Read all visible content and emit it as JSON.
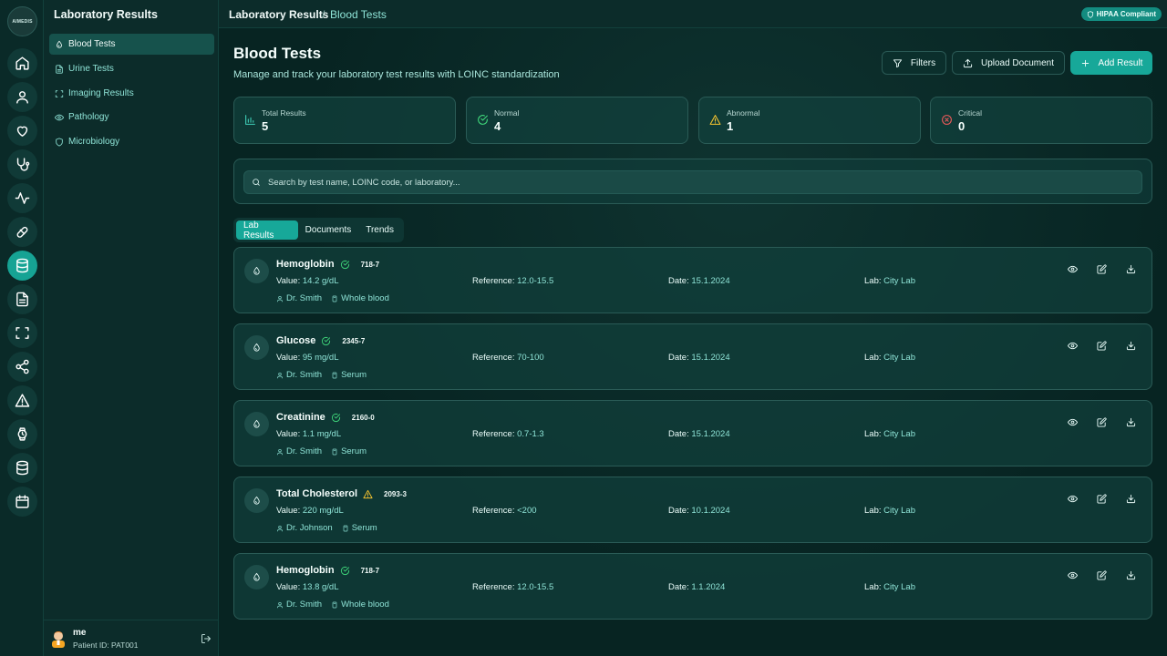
{
  "app": {
    "logo_text": "AIMEDIS",
    "rail_icons": [
      "home-icon",
      "user-icon",
      "heart-icon",
      "stethoscope-icon",
      "activity-icon",
      "pill-icon",
      "database-icon",
      "document-icon",
      "scan-icon",
      "share-icon",
      "alert-triangle-icon",
      "watch-icon",
      "database-icon",
      "calendar-icon"
    ],
    "active_rail": "database-icon"
  },
  "sidebar": {
    "title": "Laboratory Results",
    "items": [
      {
        "label": "Blood Tests",
        "icon": "blood-drop-icon",
        "active": true
      },
      {
        "label": "Urine Tests",
        "icon": "document-icon",
        "active": false
      },
      {
        "label": "Imaging Results",
        "icon": "scan-icon",
        "active": false
      },
      {
        "label": "Pathology",
        "icon": "eye-icon",
        "active": false
      },
      {
        "label": "Microbiology",
        "icon": "shield-icon",
        "active": false
      }
    ],
    "user": {
      "name": "me",
      "patient_id": "Patient ID: PAT001"
    }
  },
  "header": {
    "breadcrumb_root": "Laboratory Results",
    "breadcrumb_sep": "/",
    "breadcrumb_current": "Blood Tests",
    "badge": "HIPAA Compliant"
  },
  "page": {
    "title": "Blood Tests",
    "subtitle": "Manage and track your laboratory test results with LOINC standardization",
    "buttons": {
      "filters": "Filters",
      "upload": "Upload Document",
      "add": "Add Result"
    }
  },
  "stats": [
    {
      "label": "Total Results",
      "value": "5",
      "icon": "bar-chart-icon",
      "color": "#3fcfb8"
    },
    {
      "label": "Normal",
      "value": "4",
      "icon": "check-circle-icon",
      "color": "#3fd67a"
    },
    {
      "label": "Abnormal",
      "value": "1",
      "icon": "warning-icon",
      "color": "#f2c230"
    },
    {
      "label": "Critical",
      "value": "0",
      "icon": "x-circle-icon",
      "color": "#ef5a5a"
    }
  ],
  "search": {
    "placeholder": "Search by test name, LOINC code, or laboratory..."
  },
  "tabs": [
    {
      "label": "Lab Results",
      "active": true
    },
    {
      "label": "Documents",
      "active": false
    },
    {
      "label": "Trends",
      "active": false
    }
  ],
  "labels": {
    "value": "Value:",
    "reference": "Reference:",
    "date": "Date:",
    "lab": "Lab:"
  },
  "results": [
    {
      "name": "Hemoglobin",
      "status": "normal",
      "code": "718-7",
      "value": "14.2 g/dL",
      "reference": "12.0-15.5",
      "date": "15.1.2024",
      "lab": "City Lab",
      "doctor": "Dr. Smith",
      "specimen": "Whole blood"
    },
    {
      "name": "Glucose",
      "status": "normal",
      "code": "2345-7",
      "value": "95 mg/dL",
      "reference": "70-100",
      "date": "15.1.2024",
      "lab": "City Lab",
      "doctor": "Dr. Smith",
      "specimen": "Serum"
    },
    {
      "name": "Creatinine",
      "status": "normal",
      "code": "2160-0",
      "value": "1.1 mg/dL",
      "reference": "0.7-1.3",
      "date": "15.1.2024",
      "lab": "City Lab",
      "doctor": "Dr. Smith",
      "specimen": "Serum"
    },
    {
      "name": "Total Cholesterol",
      "status": "abnormal",
      "code": "2093-3",
      "value": "220 mg/dL",
      "reference": "<200",
      "date": "10.1.2024",
      "lab": "City Lab",
      "doctor": "Dr. Johnson",
      "specimen": "Serum"
    },
    {
      "name": "Hemoglobin",
      "status": "normal",
      "code": "718-7",
      "value": "13.8 g/dL",
      "reference": "12.0-15.5",
      "date": "1.1.2024",
      "lab": "City Lab",
      "doctor": "Dr. Smith",
      "specimen": "Whole blood"
    }
  ]
}
